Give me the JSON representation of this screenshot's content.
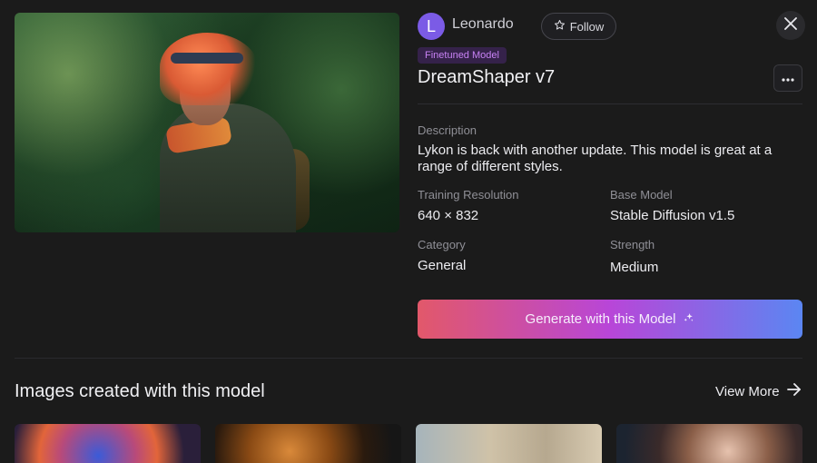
{
  "author": {
    "avatar_letter": "L",
    "name": "Leonardo",
    "follow_label": "Follow"
  },
  "model": {
    "badge": "Finetuned Model",
    "title": "DreamShaper v7",
    "description_label": "Description",
    "description": "Lykon is back with another update. This model is great at a range of different styles.",
    "training_resolution_label": "Training Resolution",
    "training_resolution": "640 × 832",
    "base_model_label": "Base Model",
    "base_model": "Stable Diffusion v1.5",
    "category_label": "Category",
    "category": "General",
    "strength_label": "Strength",
    "strength": "Medium"
  },
  "generate_label": "Generate with this Model",
  "gallery": {
    "title": "Images created with this model",
    "view_more_label": "View More"
  },
  "icons": {
    "close": "close-icon",
    "more": "more-horizontal-icon",
    "follow": "star-icon",
    "sparkle": "sparkle-icon",
    "arrow": "arrow-right-icon"
  },
  "colors": {
    "avatar": "#7b5be6",
    "badge_text": "#c782f4",
    "button_gradient_start": "#e2586a",
    "button_gradient_mid": "#b846d8",
    "button_gradient_end": "#5b86f2"
  }
}
